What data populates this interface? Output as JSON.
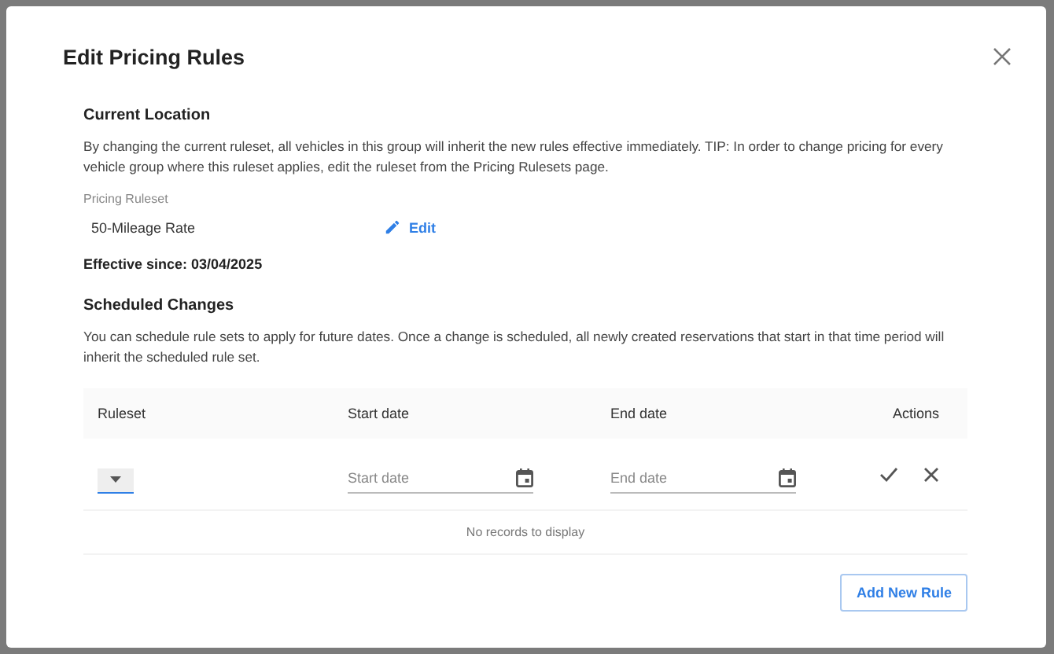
{
  "dialog": {
    "title": "Edit Pricing Rules"
  },
  "current_location": {
    "heading": "Current Location",
    "description": "By changing the current ruleset, all vehicles in this group will inherit the new rules effective immediately. TIP: In order to change pricing for every vehicle group where this ruleset applies, edit the ruleset from the Pricing Rulesets page.",
    "field_label": "Pricing Ruleset",
    "ruleset": "50-Mileage Rate",
    "edit_link": "Edit",
    "effective_since": "Effective since: 03/04/2025"
  },
  "scheduled_changes": {
    "heading": "Scheduled Changes",
    "description": "You can schedule rule sets to apply for future dates. Once a change is scheduled, all newly created reservations that start in that time period will inherit the scheduled rule set."
  },
  "table": {
    "columns": [
      "Ruleset",
      "Start date",
      "End date",
      "Actions"
    ],
    "new_row": {
      "start_placeholder": "Start date",
      "end_placeholder": "End date"
    },
    "empty_message": "No records to display"
  },
  "add_button": "Add New Rule"
}
